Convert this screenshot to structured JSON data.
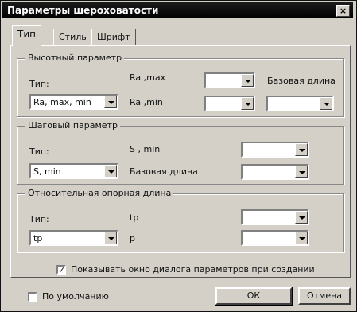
{
  "window": {
    "title": "Параметры шероховатости",
    "close": "×"
  },
  "tabs": [
    {
      "label": "Тип",
      "active": true
    },
    {
      "label": "Стиль",
      "active": false
    },
    {
      "label": "Шрифт",
      "active": false
    }
  ],
  "groups": {
    "height": {
      "title": "Высотный параметр",
      "type_label": "Тип:",
      "type_value": "Ra, max, min",
      "ra_max_label": "Ra ,max",
      "ra_min_label": "Ra ,min",
      "base_length_label": "Базовая длина",
      "ra_max_value": "",
      "ra_min_value": "",
      "base_length_value": ""
    },
    "step": {
      "title": "Шаговый параметр",
      "type_label": "Тип:",
      "type_value": "S, min",
      "s_min_label": "S , min",
      "base_length_label": "Базовая длина",
      "s_min_value": "",
      "base_length_value": ""
    },
    "relative": {
      "title": "Относительная опорная длина",
      "type_label": "Тип:",
      "type_value": "tp",
      "tp_label": "tp",
      "p_label": "p",
      "tp_value": "",
      "p_value": ""
    }
  },
  "show_dialog": {
    "label": "Показывать окно диалога параметров при создании",
    "checked": true
  },
  "default": {
    "label": "По умолчанию",
    "checked": false
  },
  "buttons": {
    "ok": "ОК",
    "cancel": "Отмена"
  }
}
